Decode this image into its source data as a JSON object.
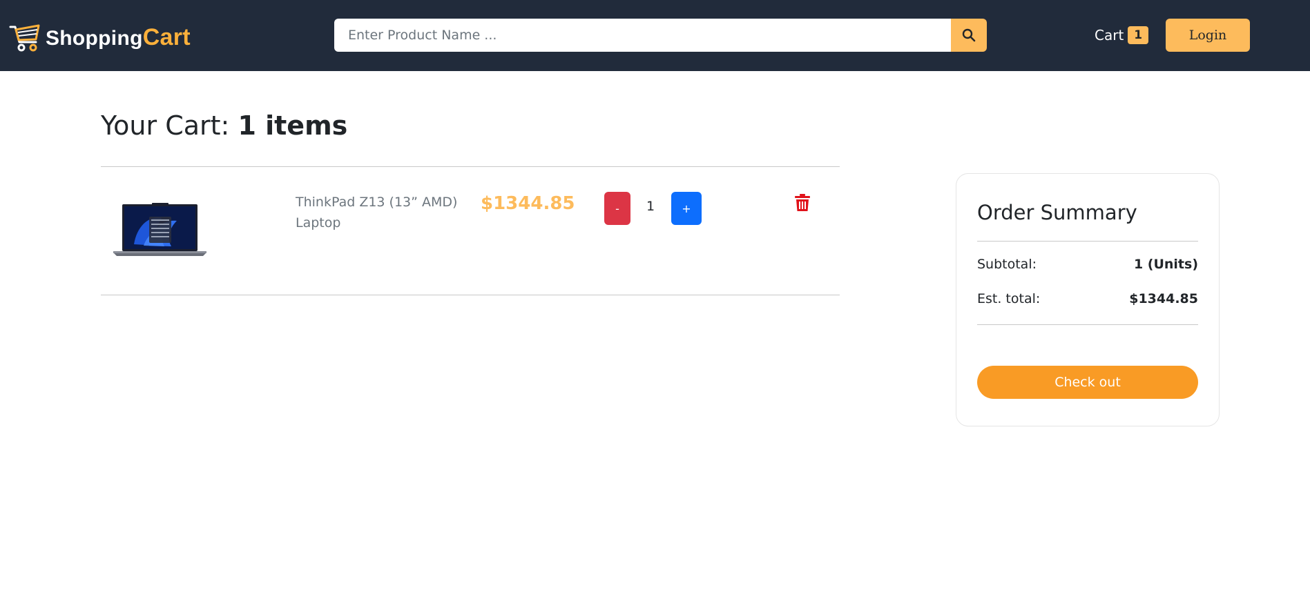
{
  "header": {
    "brand_part1": "Shopping",
    "brand_part2": "Cart",
    "search_placeholder": "Enter Product Name ...",
    "cart_label": "Cart",
    "cart_count": "1",
    "login_label": "Login"
  },
  "cart": {
    "title_prefix": "Your Cart: ",
    "title_count": "1 items",
    "items": [
      {
        "name": "ThinkPad Z13 (13” AMD) Laptop",
        "price": "$1344.85",
        "quantity": "1",
        "minus_label": "-",
        "plus_label": "+"
      }
    ]
  },
  "summary": {
    "title": "Order Summary",
    "subtotal_label": "Subtotal:",
    "subtotal_value": "1 (Units)",
    "total_label": "Est. total:",
    "total_value": "$1344.85",
    "checkout_label": "Check out"
  },
  "colors": {
    "navbar": "#212b3b",
    "accent": "#fdbb5c",
    "brand_orange": "#fbb03b",
    "checkout": "#f99b25",
    "danger": "#dc3545",
    "primary": "#0d6efd"
  }
}
